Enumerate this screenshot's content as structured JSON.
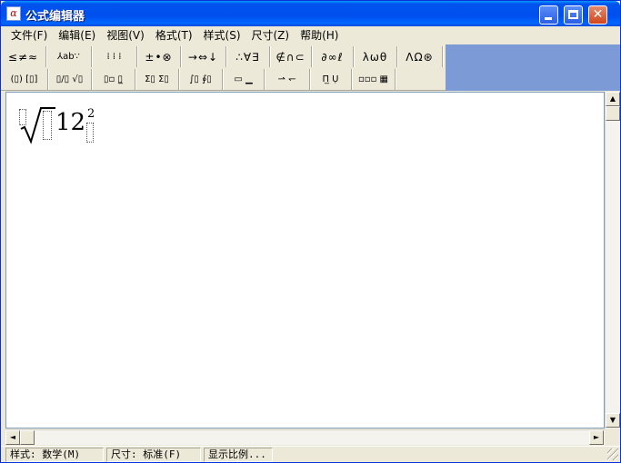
{
  "window": {
    "title": "公式编辑器",
    "icon_glyph": "α",
    "controls": {
      "minimize": "",
      "maximize": "",
      "close": "✕"
    }
  },
  "menu": [
    {
      "label": "文件(F)"
    },
    {
      "label": "编辑(E)"
    },
    {
      "label": "视图(V)"
    },
    {
      "label": "格式(T)"
    },
    {
      "label": "样式(S)"
    },
    {
      "label": "尺寸(Z)"
    },
    {
      "label": "帮助(H)"
    }
  ],
  "toolbar": {
    "row1": [
      {
        "symbols": "≤≠≈"
      },
      {
        "symbols": "⅄ab∵"
      },
      {
        "symbols": "⁞ ⁞ ⁞"
      },
      {
        "symbols": "±•⊗"
      },
      {
        "symbols": "→⇔↓"
      },
      {
        "symbols": "∴∀∃"
      },
      {
        "symbols": "∉∩⊂"
      },
      {
        "symbols": "∂∞ℓ"
      },
      {
        "symbols": "λωθ"
      },
      {
        "symbols": "ΛΩ⊛"
      }
    ],
    "row2": [
      {
        "symbols": "(▯) [▯]"
      },
      {
        "symbols": "▯/▯ √▯"
      },
      {
        "symbols": "▯▫ ▯̲"
      },
      {
        "symbols": "Σ▯ Σ▯"
      },
      {
        "symbols": "∫▯ ∮▯"
      },
      {
        "symbols": "▭ ▁"
      },
      {
        "symbols": "⇀ ↽"
      },
      {
        "symbols": "Π̲ Ụ"
      },
      {
        "symbols": "▫▫▫ ▦"
      }
    ]
  },
  "formula": {
    "base": "12",
    "superscript": "2"
  },
  "scroll": {
    "up": "▲",
    "down": "▼",
    "left": "◄",
    "right": "►"
  },
  "status": {
    "style": "样式: 数学(M)",
    "size": "尺寸: 标准(F)",
    "zoom": "显示比例..."
  }
}
